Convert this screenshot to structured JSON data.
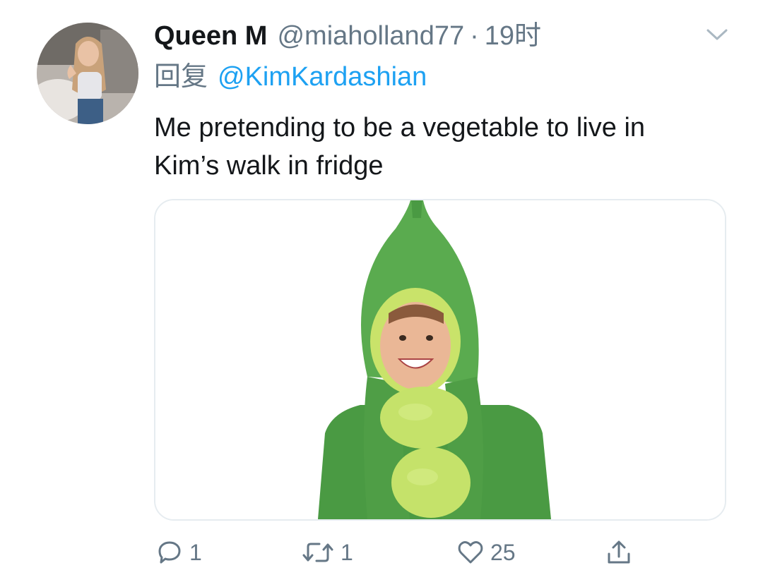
{
  "tweet": {
    "display_name": "Queen M",
    "handle": "@miaholland77",
    "separator": "·",
    "time": "19时",
    "reply_prefix": "回复",
    "reply_to": "@KimKardashian",
    "text_lines": [
      "Me pretending to be a vegetable to live in",
      "Kim’s walk in fridge"
    ],
    "media_description_icon": "pea-pod-costume-photo"
  },
  "actions": {
    "reply_count": "1",
    "retweet_count": "1",
    "like_count": "25",
    "share_label": ""
  },
  "icons": {
    "more": "chevron-down-icon",
    "reply": "comment-bubble-icon",
    "retweet": "retweet-arrows-icon",
    "like": "heart-icon",
    "share": "share-upload-icon"
  },
  "colors": {
    "text": "#14171a",
    "secondary": "#657786",
    "link": "#1da1f2",
    "border": "#e6ecf0"
  }
}
